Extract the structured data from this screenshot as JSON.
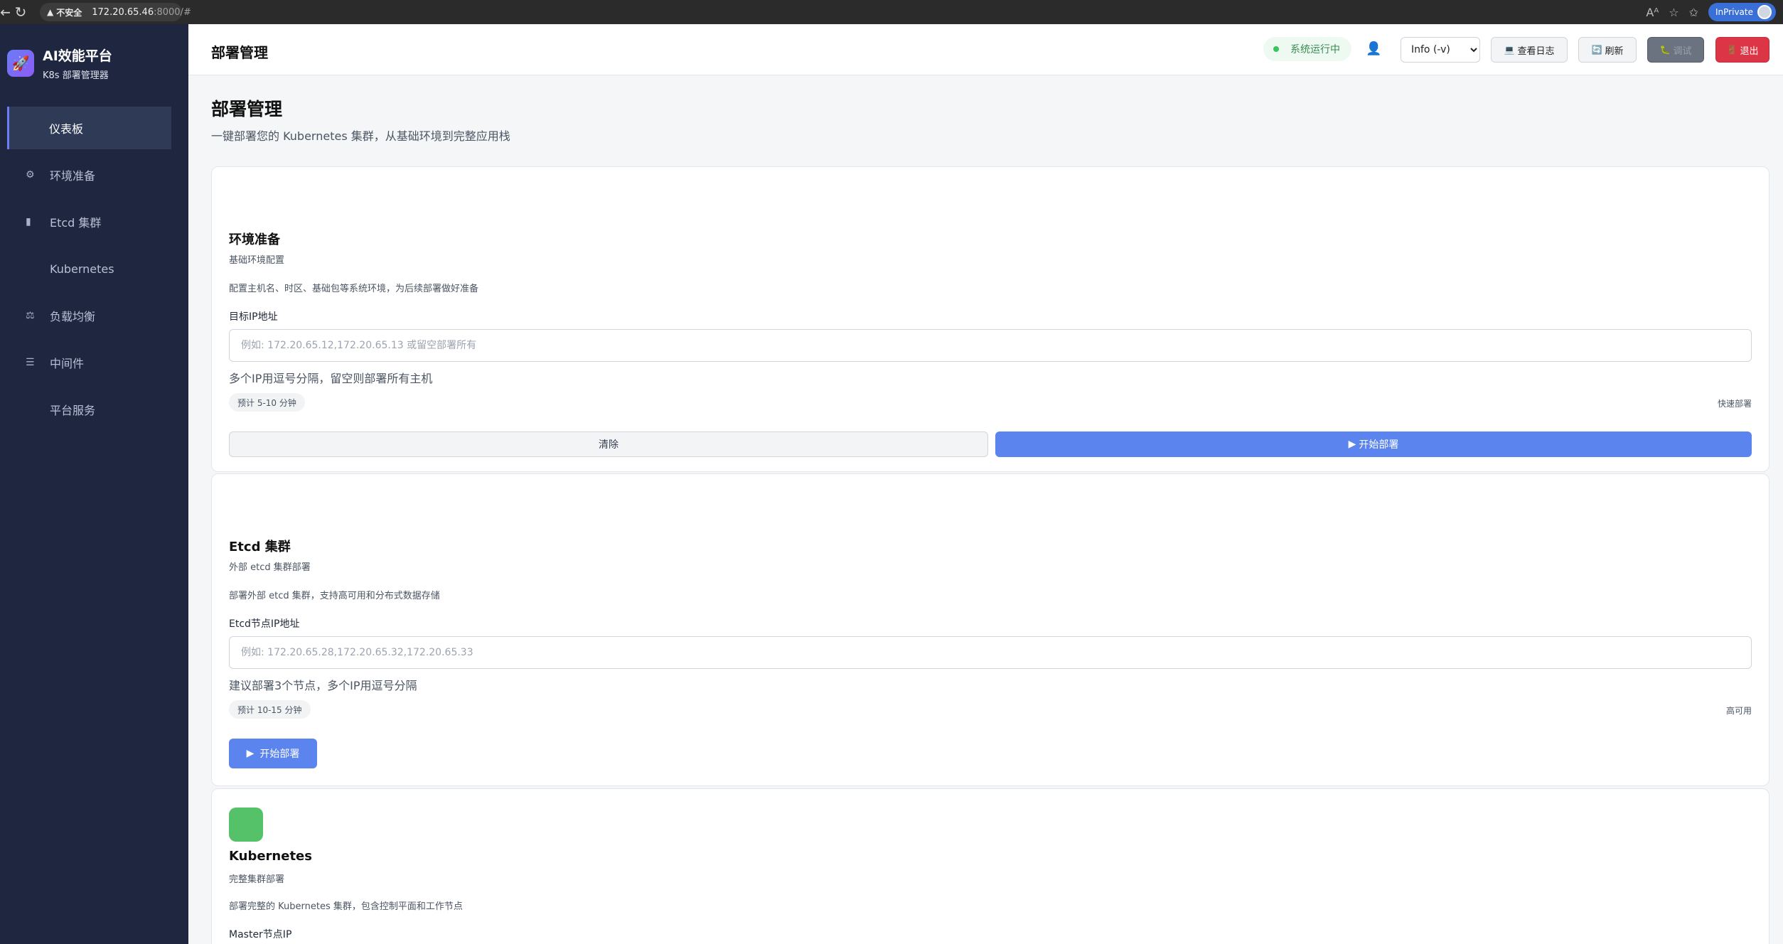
{
  "browser": {
    "insecure_label": "不安全",
    "url_host": "172.20.65.46",
    "url_path": ":8000/#",
    "inprivate_label": "InPrivate"
  },
  "sidebar": {
    "brand_title": "AI效能平台",
    "brand_subtitle": "K8s 部署管理器",
    "items": [
      {
        "label": "仪表板",
        "icon": "dashboard"
      },
      {
        "label": "环境准备",
        "icon": "gear-icon"
      },
      {
        "label": "Etcd 集群",
        "icon": "database-icon"
      },
      {
        "label": "Kubernetes",
        "icon": ""
      },
      {
        "label": "负载均衡",
        "icon": "balance-icon"
      },
      {
        "label": "中间件",
        "icon": "stack-icon"
      },
      {
        "label": "平台服务",
        "icon": ""
      }
    ]
  },
  "header": {
    "title": "部署管理",
    "status": "系统运行中",
    "log_level": "Info (-v)",
    "log_level_options": [
      "Info (-v)"
    ],
    "view_logs": "查看日志",
    "refresh": "刷新",
    "debug": "调试",
    "logout": "退出"
  },
  "main": {
    "title": "部署管理",
    "description": "一键部署您的 Kubernetes 集群，从基础环境到完整应用栈",
    "cards": [
      {
        "title": "环境准备",
        "subtitle": "基础环境配置",
        "description": "配置主机名、时区、基础包等系统环境，为后续部署做好准备",
        "field_label": "目标IP地址",
        "placeholder": "例如: 172.20.65.12,172.20.65.13 或留空部署所有",
        "hint": "多个IP用逗号分隔，留空则部署所有主机",
        "time_badge": "预计 5-10 分钟",
        "tag": "快速部署",
        "clear_label": "清除",
        "deploy_label": "开始部署"
      },
      {
        "title": "Etcd 集群",
        "subtitle": "外部 etcd 集群部署",
        "description": "部署外部 etcd 集群，支持高可用和分布式数据存储",
        "field_label": "Etcd节点IP地址",
        "placeholder": "例如: 172.20.65.28,172.20.65.32,172.20.65.33",
        "hint": "建议部署3个节点，多个IP用逗号分隔",
        "time_badge": "预计 10-15 分钟",
        "tag": "高可用",
        "deploy_label": "开始部署"
      },
      {
        "title": "Kubernetes",
        "subtitle": "完整集群部署",
        "description": "部署完整的 Kubernetes 集群，包含控制平面和工作节点",
        "field_label": "Master节点IP",
        "icon_color": "#55c26a"
      }
    ]
  },
  "colors": {
    "sidebar_bg": "#1e2640",
    "primary": "#5b84ee",
    "danger": "#dc3545",
    "success": "#34c759"
  }
}
